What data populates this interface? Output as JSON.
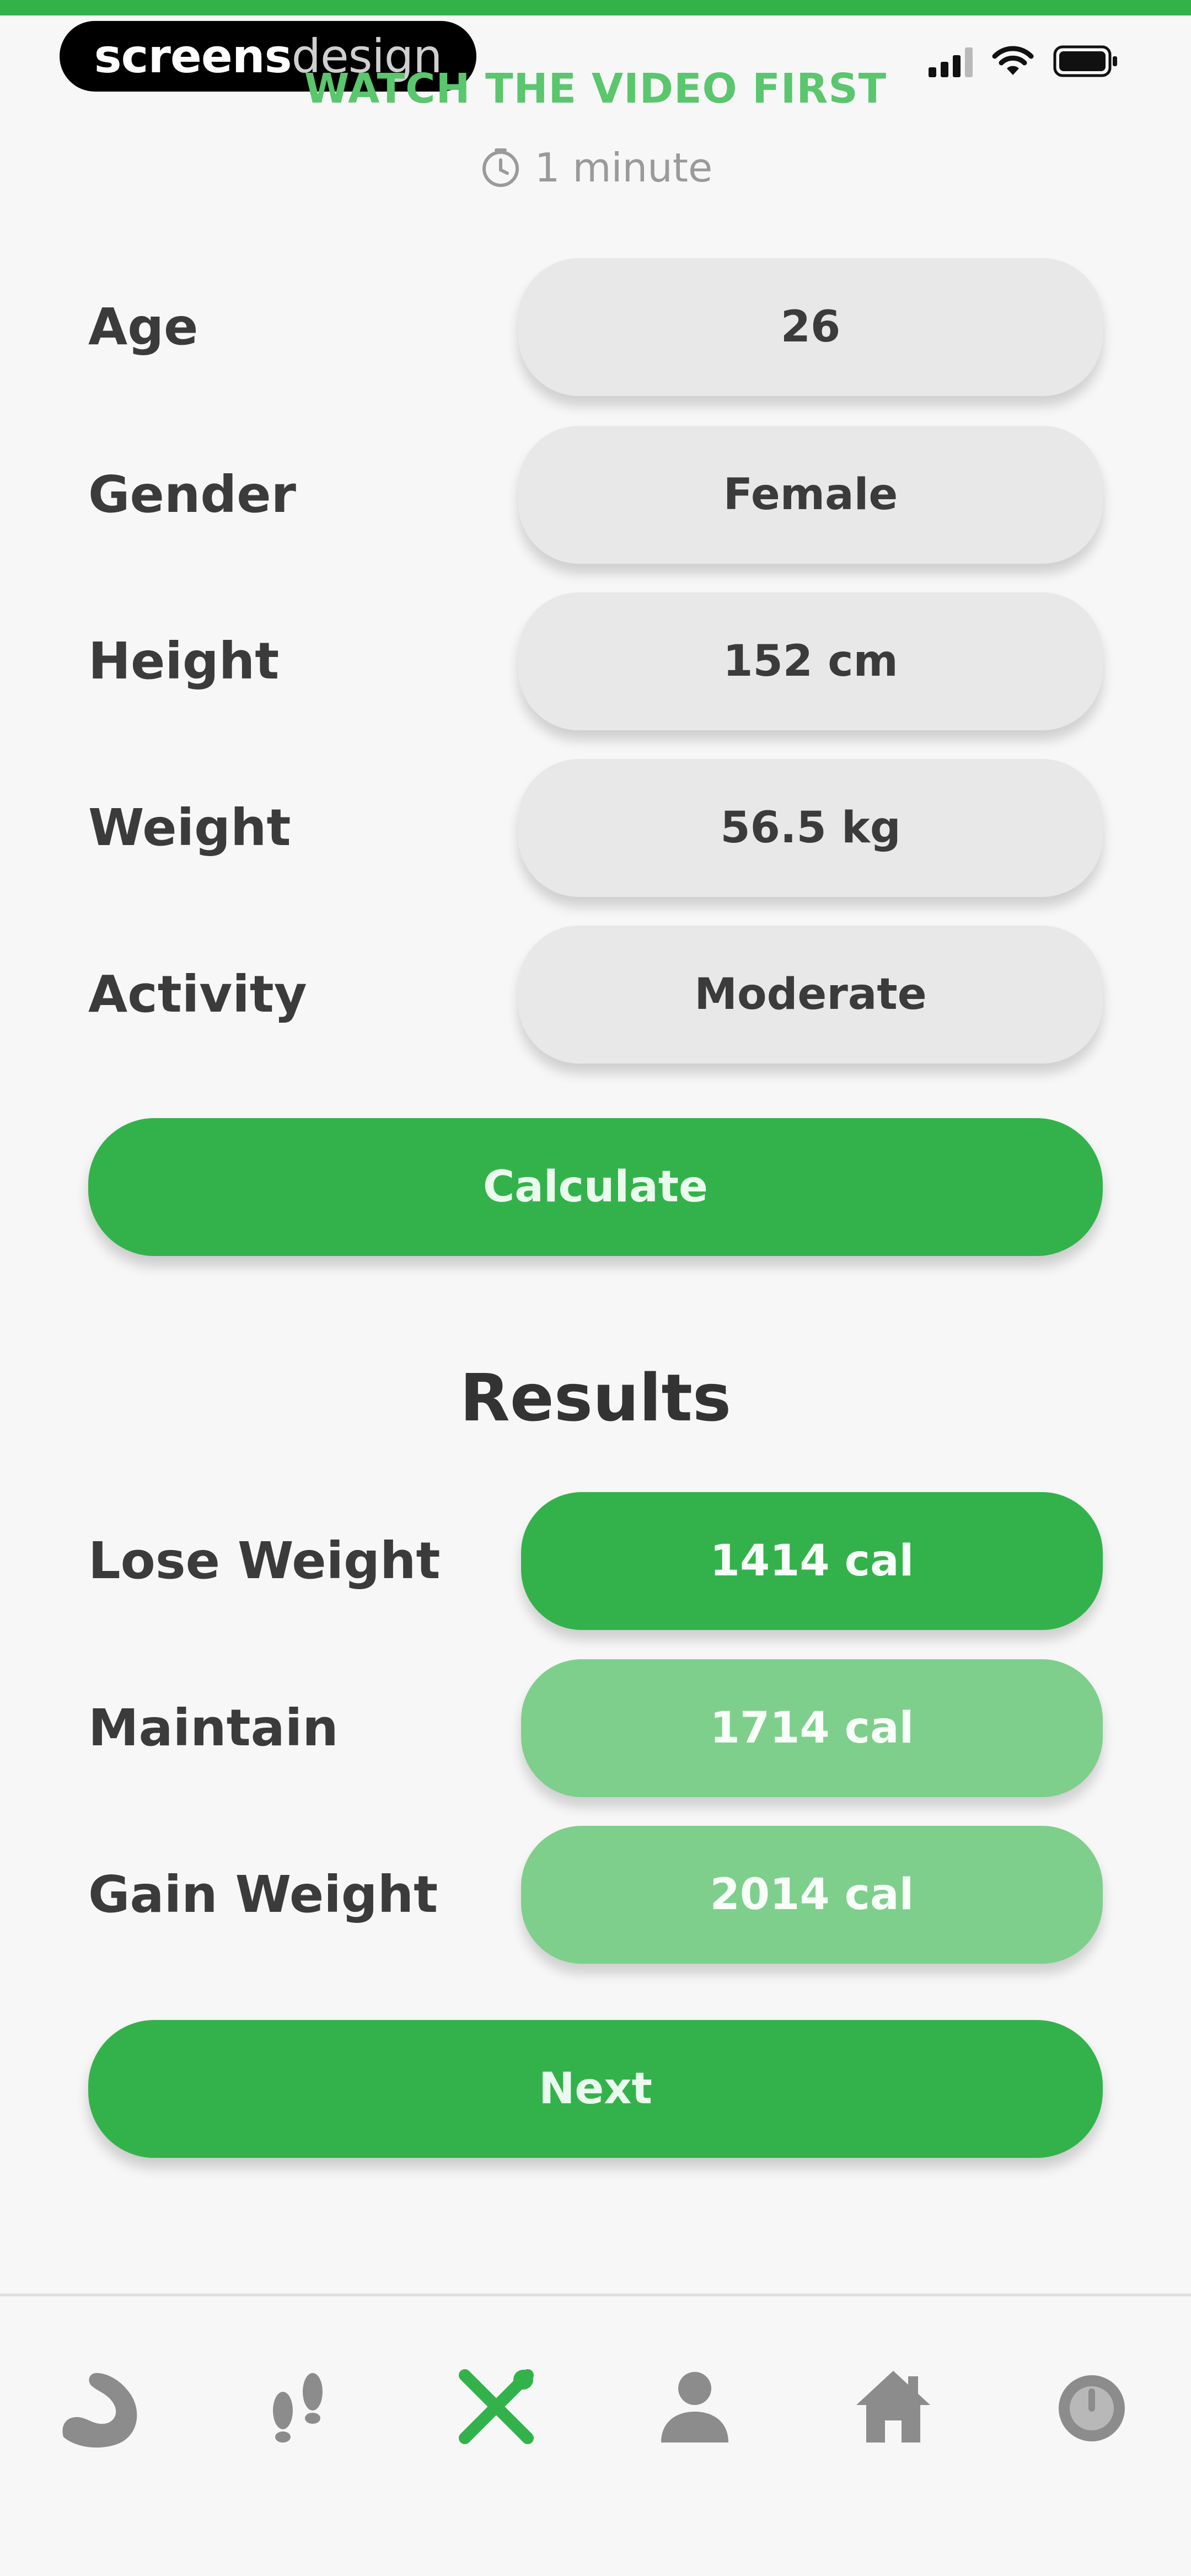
{
  "watermark": {
    "brand_bold": "screens",
    "brand_light": "design"
  },
  "header": {
    "video_link": "WATCH THE VIDEO FIRST",
    "duration": "1 minute"
  },
  "form": {
    "rows": [
      {
        "label": "Age",
        "value": "26"
      },
      {
        "label": "Gender",
        "value": "Female"
      },
      {
        "label": "Height",
        "value": "152 cm"
      },
      {
        "label": "Weight",
        "value": "56.5 kg"
      },
      {
        "label": "Activity",
        "value": "Moderate"
      }
    ],
    "calculate_label": "Calculate"
  },
  "results": {
    "title": "Results",
    "rows": [
      {
        "label": "Lose Weight",
        "value": "1414 cal",
        "color": "#33b24b"
      },
      {
        "label": "Maintain",
        "value": "1714 cal",
        "color": "#7ecf8c"
      },
      {
        "label": "Gain Weight",
        "value": "2014 cal",
        "color": "#7ecf8c"
      }
    ],
    "next_label": "Next"
  },
  "nav": {
    "items": [
      {
        "icon": "bicep-icon",
        "active": false
      },
      {
        "icon": "footprints-icon",
        "active": false
      },
      {
        "icon": "fork-knife-icon",
        "active": true
      },
      {
        "icon": "person-icon",
        "active": false
      },
      {
        "icon": "home-icon",
        "active": false
      },
      {
        "icon": "timer-icon",
        "active": false
      }
    ]
  },
  "colors": {
    "primary": "#33b24b",
    "primary_light": "#7ecf8c",
    "link": "#5ac66d",
    "inactive_icon": "#8c8c8c"
  }
}
